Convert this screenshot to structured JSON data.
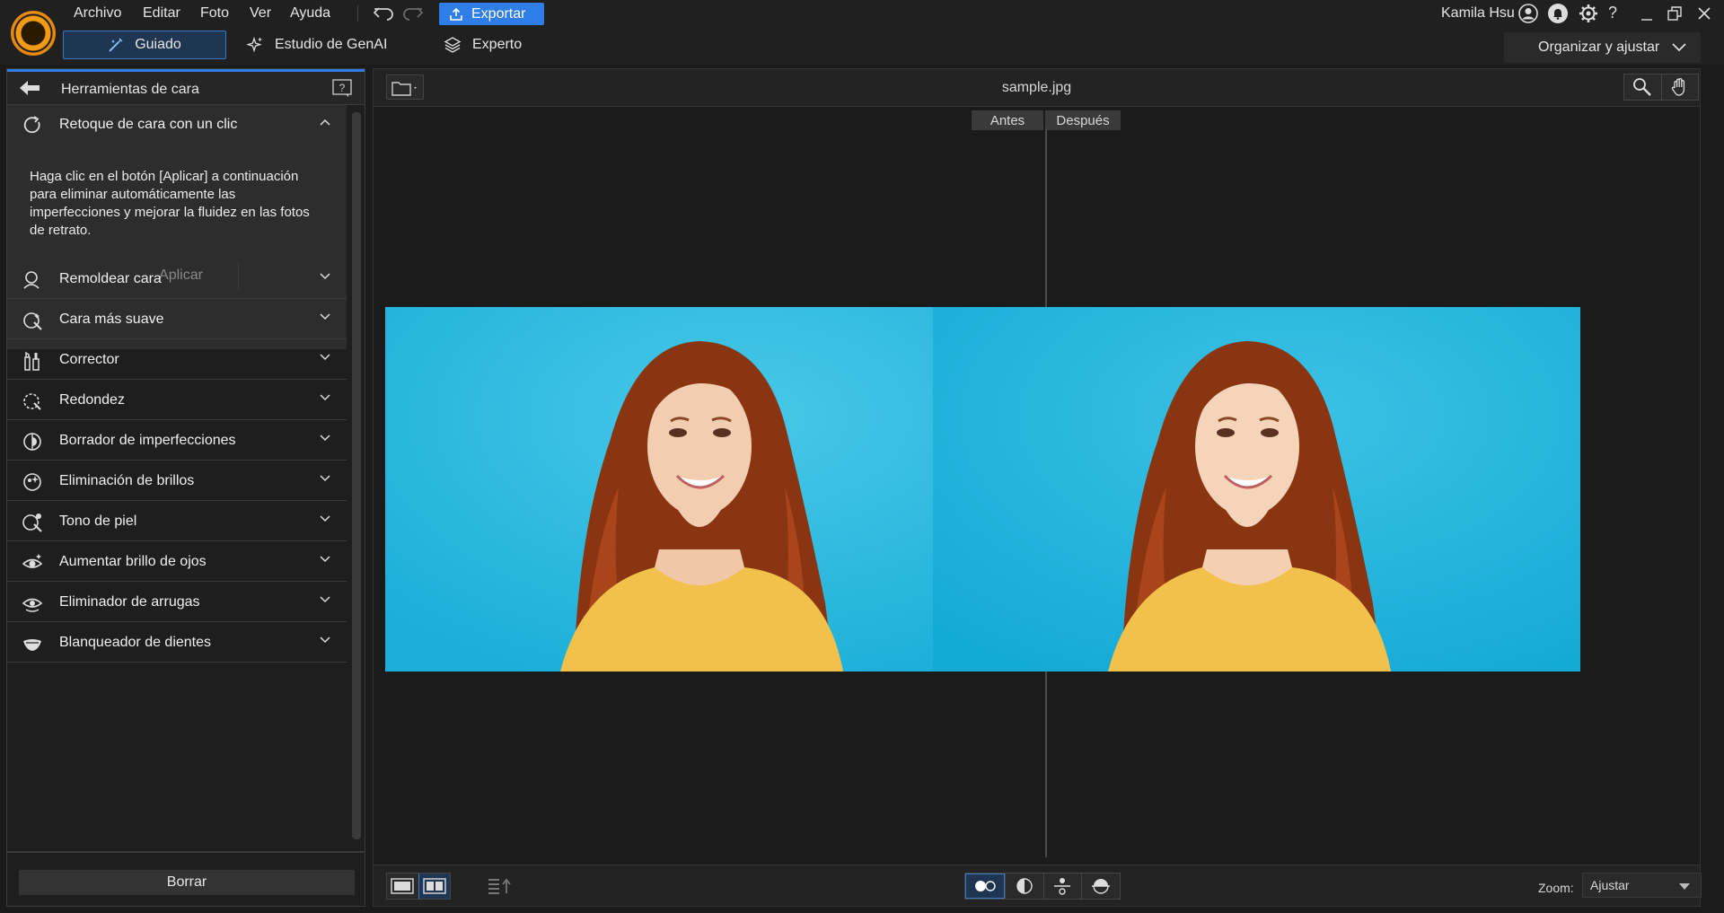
{
  "app": {
    "name": "PhotoDirector",
    "accent_color": "#2f7ee8",
    "logo_color": "#f39a16"
  },
  "menu": [
    "Archivo",
    "Editar",
    "Foto",
    "Ver",
    "Ayuda"
  ],
  "toolbar": {
    "export_label": "Exportar",
    "undo_icon": "undo-icon",
    "redo_icon": "redo-icon"
  },
  "account": {
    "user_name": "Kamila Hsu"
  },
  "modes": [
    {
      "label": "Guiado",
      "icon": "wand-icon",
      "selected": true
    },
    {
      "label": "Estudio de GenAI",
      "icon": "sparkle-icon",
      "selected": false
    },
    {
      "label": "Experto",
      "icon": "layers-icon",
      "selected": false
    }
  ],
  "workspace": {
    "label": "Organizar y ajustar"
  },
  "panel": {
    "title": "Herramientas de cara",
    "expanded_section": {
      "label": "Retoque de cara con un clic",
      "description": "Haga clic en el botón [Aplicar] a continuación para eliminar automáticamente las imperfecciones y mejorar la fluidez en las fotos de retrato.",
      "apply_label": "Aplicar"
    },
    "sections": [
      {
        "label": "Remoldear cara",
        "icon": "face-reshape-icon"
      },
      {
        "label": "Cara más suave",
        "icon": "face-smooth-icon"
      },
      {
        "label": "Corrector",
        "icon": "concealer-icon"
      },
      {
        "label": "Redondez",
        "icon": "face-roundness-icon"
      },
      {
        "label": "Borrador de imperfecciones",
        "icon": "blemish-eraser-icon"
      },
      {
        "label": "Eliminación de brillos",
        "icon": "shine-removal-icon"
      },
      {
        "label": "Tono de piel",
        "icon": "skin-tone-icon"
      },
      {
        "label": "Aumentar brillo de ojos",
        "icon": "eye-brighten-icon"
      },
      {
        "label": "Eliminador de arrugas",
        "icon": "wrinkle-remover-icon"
      },
      {
        "label": "Blanqueador de dientes",
        "icon": "teeth-whitener-icon"
      }
    ],
    "clear_label": "Borrar"
  },
  "viewer": {
    "file_name": "sample.jpg",
    "before_label": "Antes",
    "after_label": "Después",
    "zoom_label": "Zoom:",
    "zoom_value": "Ajustar"
  }
}
